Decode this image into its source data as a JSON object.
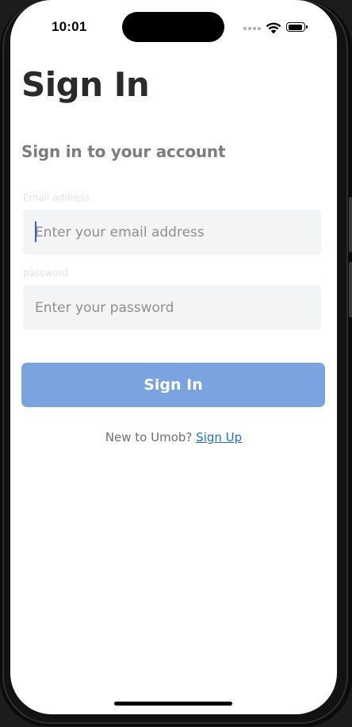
{
  "status_bar": {
    "time": "10:01"
  },
  "header": {
    "title": "Sign In",
    "subtitle": "Sign in to your account"
  },
  "form": {
    "email": {
      "label": "Email address",
      "placeholder": "Enter your email address",
      "value": ""
    },
    "password": {
      "label": "password",
      "placeholder": "Enter your password",
      "value": ""
    },
    "submit_label": "Sign In",
    "submit_color": "#7ba3e0"
  },
  "footer": {
    "prompt": "New to Umob?",
    "link_label": "Sign Up",
    "link_color": "#1d6fd1"
  },
  "icons": [
    "cellular-signal-icon",
    "wifi-icon",
    "battery-icon"
  ]
}
